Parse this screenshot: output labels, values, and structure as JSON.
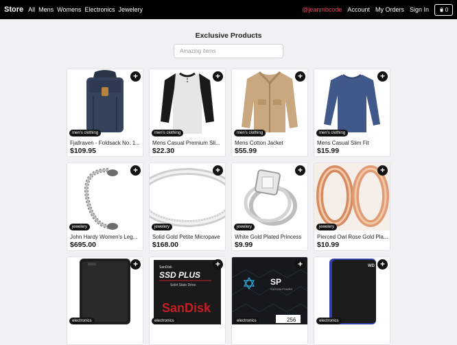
{
  "nav": {
    "brand": "Store",
    "links": [
      "All",
      "Mens",
      "Womens",
      "Electronics",
      "Jewelery"
    ],
    "user": "@jeanmbcode",
    "account": "Account",
    "orders": "My Orders",
    "signin": "Sign In",
    "cart_count": "0"
  },
  "main": {
    "title": "Exclusive Products",
    "search_placeholder": "Amazing items"
  },
  "products": [
    {
      "category": "men's clothing",
      "title": "Fjallraven - Foldsack No. 1...",
      "price": "$109.95"
    },
    {
      "category": "men's clothing",
      "title": "Mens Casual Premium Sli...",
      "price": "$22.30"
    },
    {
      "category": "men's clothing",
      "title": "Mens Cotton Jacket",
      "price": "$55.99"
    },
    {
      "category": "men's clothing",
      "title": "Mens Casual Slim Fit",
      "price": "$15.99"
    },
    {
      "category": "jewelery",
      "title": "John Hardy Women's Leg...",
      "price": "$695.00"
    },
    {
      "category": "jewelery",
      "title": "Solid Gold Petite Micropave",
      "price": "$168.00"
    },
    {
      "category": "jewelery",
      "title": "White Gold Plated Princess",
      "price": "$9.99"
    },
    {
      "category": "jewelery",
      "title": "Pierced Owl Rose Gold Pla...",
      "price": "$10.99"
    },
    {
      "category": "electronics",
      "title": "",
      "price": ""
    },
    {
      "category": "electronics",
      "title": "",
      "price": ""
    },
    {
      "category": "electronics",
      "title": "",
      "price": ""
    },
    {
      "category": "electronics",
      "title": "",
      "price": ""
    }
  ],
  "image_text": {
    "ssd_brand": "SanDisk",
    "ssd_line1": "SSD PLUS",
    "ssd_line2": "Solid State Drive",
    "ssd_logo": "SanDisk",
    "sp_logo": "SP",
    "sp_sub": "SILICON POWER",
    "sp_size": "256"
  }
}
